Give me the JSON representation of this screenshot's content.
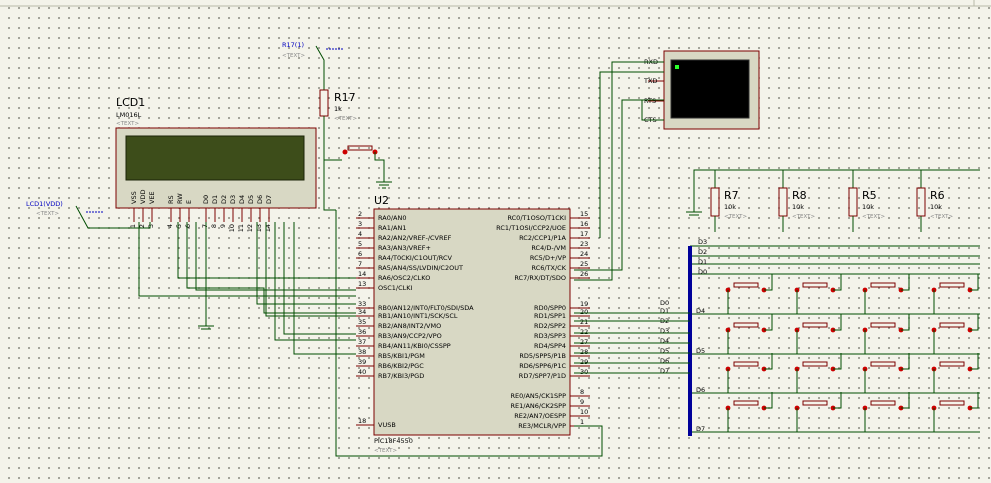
{
  "lcd": {
    "ref": "LCD1",
    "model": "LM016L",
    "text_field": "<TEXT>",
    "power_label": "LCD1(VDD)",
    "power_text": "<TEXT>",
    "pins": [
      "VSS",
      "VDD",
      "VEE",
      "RS",
      "RW",
      "E",
      "D0",
      "D1",
      "D2",
      "D3",
      "D4",
      "D5",
      "D6",
      "D7"
    ],
    "pin_numbers": [
      "1",
      "2",
      "3",
      "4",
      "5",
      "6",
      "7",
      "8",
      "9",
      "10",
      "11",
      "12",
      "13",
      "14"
    ]
  },
  "r17": {
    "ref": "R17",
    "value": "1k",
    "text_field": "<TEXT>",
    "net_label": "R17(1)",
    "net_text": "<TEXT>"
  },
  "mcu": {
    "ref": "U2",
    "model": "PIC18F4550",
    "text_field": "<TEXT>",
    "left_pins": [
      {
        "num": "2",
        "name": "RA0/AN0"
      },
      {
        "num": "3",
        "name": "RA1/AN1"
      },
      {
        "num": "4",
        "name": "RA2/AN2/VREF-/CVREF"
      },
      {
        "num": "5",
        "name": "RA3/AN3/VREF+"
      },
      {
        "num": "6",
        "name": "RA4/T0CKI/C1OUT/RCV"
      },
      {
        "num": "7",
        "name": "RA5/AN4/SS/LVDIN/C2OUT"
      },
      {
        "num": "14",
        "name": "RA6/OSC2/CLKO"
      },
      {
        "num": "13",
        "name": "OSC1/CLKI"
      },
      {
        "num": "33",
        "name": "RB0/AN12/INT0/FLT0/SDI/SDA"
      },
      {
        "num": "34",
        "name": "RB1/AN10/INT1/SCK/SCL"
      },
      {
        "num": "35",
        "name": "RB2/AN8/INT2/VMO"
      },
      {
        "num": "36",
        "name": "RB3/AN9/CCP2/VPO"
      },
      {
        "num": "37",
        "name": "RB4/AN11/KBI0/CSSPP"
      },
      {
        "num": "38",
        "name": "RB5/KBI1/PGM"
      },
      {
        "num": "39",
        "name": "RB6/KBI2/PGC"
      },
      {
        "num": "40",
        "name": "RB7/KBI3/PGD"
      },
      {
        "num": "18",
        "name": "VUSB"
      }
    ],
    "right_pins": [
      {
        "num": "15",
        "name": "RC0/T1OSO/T1CKI"
      },
      {
        "num": "16",
        "name": "RC1/T1OSI/CCP2/UOE"
      },
      {
        "num": "17",
        "name": "RC2/CCP1/P1A"
      },
      {
        "num": "23",
        "name": "RC4/D-/VM"
      },
      {
        "num": "24",
        "name": "RC5/D+/VP"
      },
      {
        "num": "25",
        "name": "RC6/TX/CK"
      },
      {
        "num": "26",
        "name": "RC7/RX/DT/SDO"
      },
      {
        "num": "19",
        "name": "RD0/SPP0"
      },
      {
        "num": "20",
        "name": "RD1/SPP1"
      },
      {
        "num": "21",
        "name": "RD2/SPP2"
      },
      {
        "num": "22",
        "name": "RD3/SPP3"
      },
      {
        "num": "27",
        "name": "RD4/SPP4"
      },
      {
        "num": "28",
        "name": "RD5/SPP5/P1B"
      },
      {
        "num": "29",
        "name": "RD6/SPP6/P1C"
      },
      {
        "num": "30",
        "name": "RD7/SPP7/P1D"
      },
      {
        "num": "8",
        "name": "RE0/AN5/CK1SPP"
      },
      {
        "num": "9",
        "name": "RE1/AN6/CK2SPP"
      },
      {
        "num": "10",
        "name": "RE2/AN7/OESPP"
      },
      {
        "num": "1",
        "name": "RE3/MCLR/VPP"
      }
    ],
    "rd_net_labels": [
      "D0",
      "D1",
      "D2",
      "D3",
      "D4",
      "D5",
      "D6",
      "D7"
    ]
  },
  "terminal": {
    "pins": [
      "RXD",
      "TXD",
      "RTS",
      "CTS"
    ]
  },
  "resistors": [
    {
      "ref": "R7",
      "value": "10k",
      "text_field": "<TEXT>"
    },
    {
      "ref": "R8",
      "value": "10k",
      "text_field": "<TEXT>"
    },
    {
      "ref": "R5",
      "value": "10k",
      "text_field": "<TEXT>"
    },
    {
      "ref": "R6",
      "value": "10k",
      "text_field": "<TEXT>"
    }
  ],
  "bus": {
    "top_labels": [
      "D3",
      "D2",
      "D1",
      "D0"
    ],
    "row_labels": [
      "D4",
      "D5",
      "D6",
      "D7"
    ]
  },
  "colors": {
    "wire": "#004d00",
    "component_outline": "#7b0000",
    "component_fill": "#d8d8c4",
    "bus": "#000099",
    "net_label": "#0000c0",
    "lcd_screen": "#3d4d1a",
    "terminal_screen": "#000000",
    "terminal_cursor": "#2aff2a"
  }
}
